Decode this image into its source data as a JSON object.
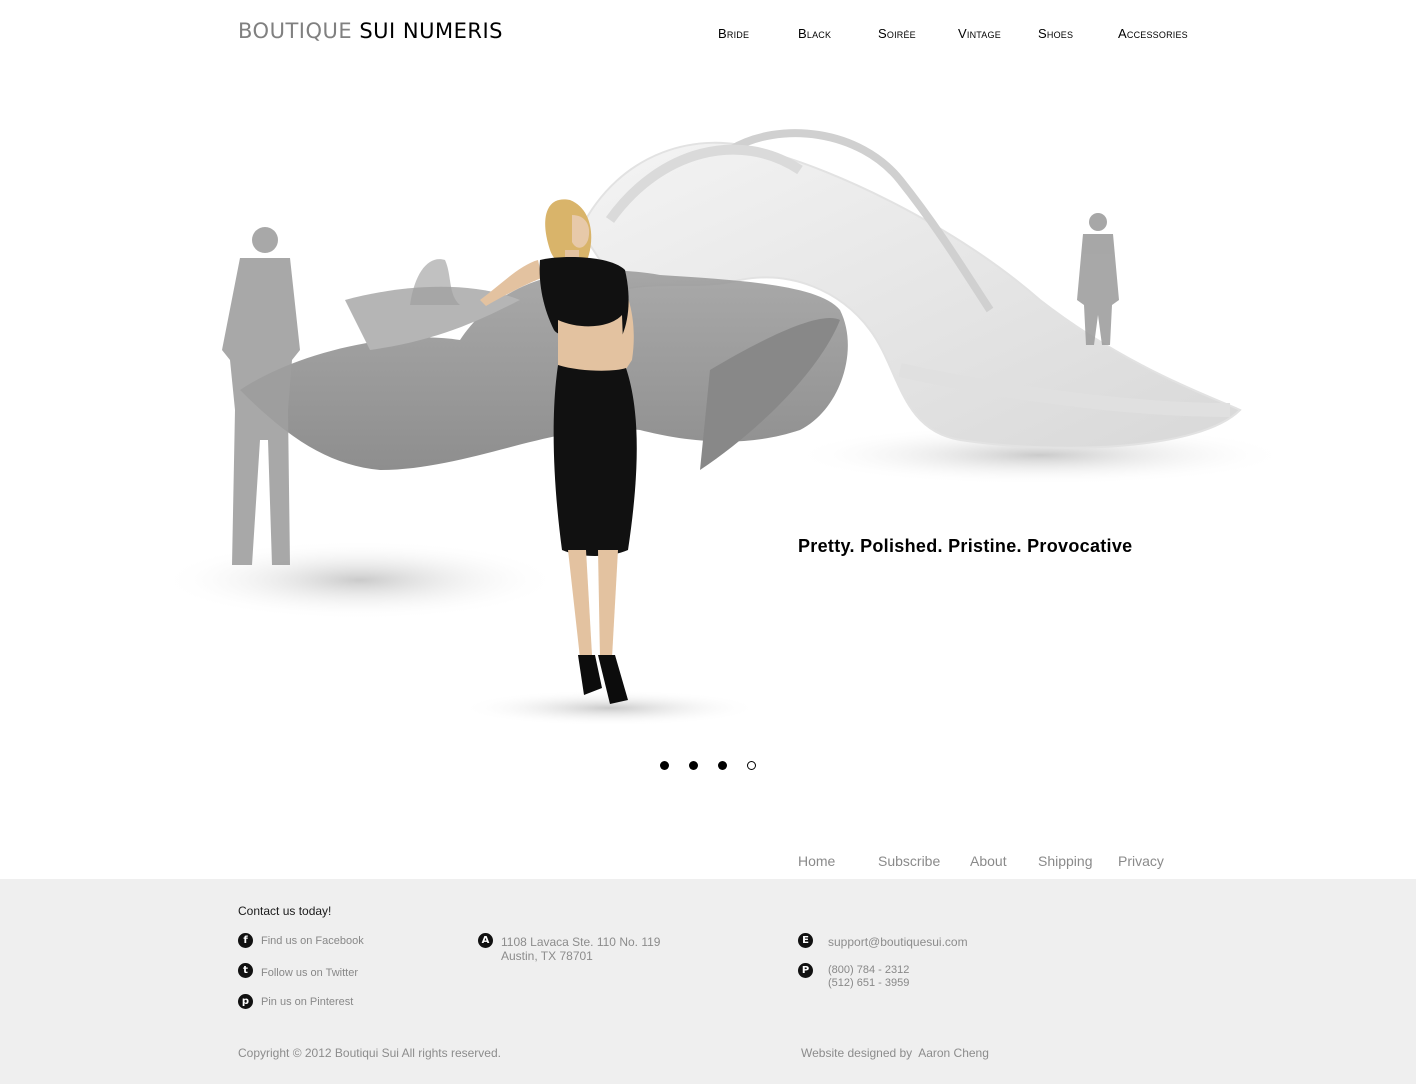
{
  "logo": {
    "part1": "BOUTIQUE",
    "part2": "SUI NUMERIS"
  },
  "nav": {
    "items": [
      {
        "label": "Bride"
      },
      {
        "label": "Black"
      },
      {
        "label": "Soirée"
      },
      {
        "label": "Vintage"
      },
      {
        "label": "Shoes"
      },
      {
        "label": "Accessories"
      }
    ]
  },
  "hero": {
    "tagline": "Pretty. Polished. Pristine. Provocative",
    "slides_total": 4,
    "active_slide": 4
  },
  "footer_links": {
    "items": [
      {
        "label": "Home"
      },
      {
        "label": "Subscribe"
      },
      {
        "label": "About"
      },
      {
        "label": "Shipping"
      },
      {
        "label": "Privacy"
      }
    ]
  },
  "contact": {
    "title": "Contact us today!",
    "social": [
      {
        "label": "Find us on Facebook",
        "icon": "facebook-icon",
        "glyph": "f"
      },
      {
        "label": "Follow us on Twitter",
        "icon": "twitter-icon",
        "glyph": "t"
      },
      {
        "label": "Pin us on Pinterest",
        "icon": "pinterest-icon",
        "glyph": "p"
      }
    ],
    "address": {
      "icon_glyph": "A",
      "line1": "1108 Lavaca Ste. 110 No. 119",
      "line2": "Austin, TX 78701"
    },
    "email": {
      "icon_glyph": "E",
      "value": "support@boutiquesui.com"
    },
    "phone": {
      "icon_glyph": "P",
      "line1": "(800) 784 - 2312",
      "line2": "(512) 651 - 3959"
    }
  },
  "copyright": "Copyright © 2012 Boutiqui Sui All rights reserved.",
  "credit": "Website designed by  Aaron Cheng",
  "colors": {
    "footer_bg": "#efefef",
    "muted_text": "#888888",
    "text": "#000000"
  }
}
